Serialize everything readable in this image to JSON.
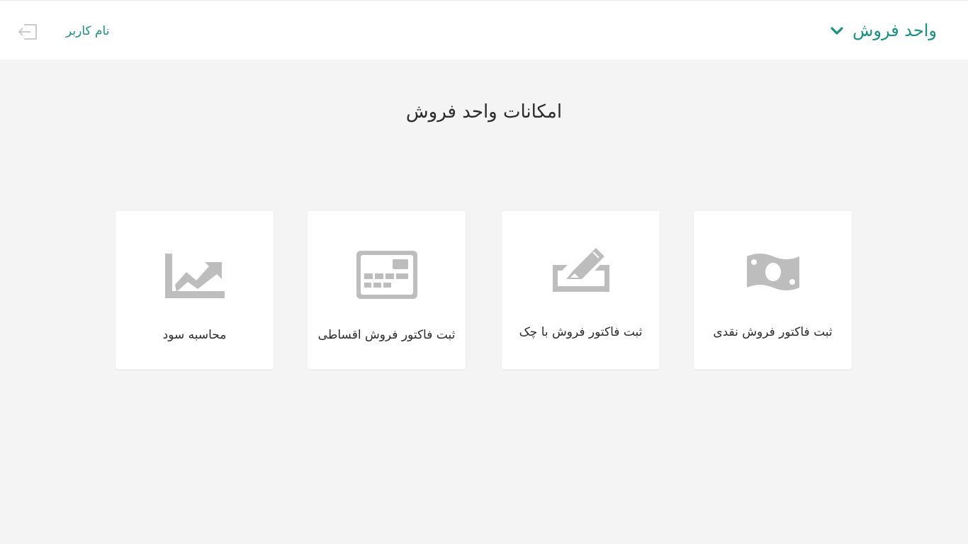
{
  "header": {
    "unit_title": "واحد فروش",
    "user_name": "نام کاربر",
    "icons": {
      "dropdown": "chevron-down-icon",
      "logout": "logout-icon"
    }
  },
  "main": {
    "title": "امکانات واحد فروش",
    "cards": [
      {
        "label": "ثبت فاکتور فروش نقدی",
        "icon": "money-bill-icon"
      },
      {
        "label": "ثبت فاکتور فروش با چک",
        "icon": "check-signature-icon"
      },
      {
        "label": "ثبت فاکتور فروش اقساطی",
        "icon": "installment-card-icon"
      },
      {
        "label": "محاسبه سود",
        "icon": "chart-area-icon"
      }
    ]
  },
  "colors": {
    "accent": "#1a9180",
    "icon_gray": "#bdbdbd",
    "background": "#f4f4f4",
    "card": "#ffffff"
  }
}
